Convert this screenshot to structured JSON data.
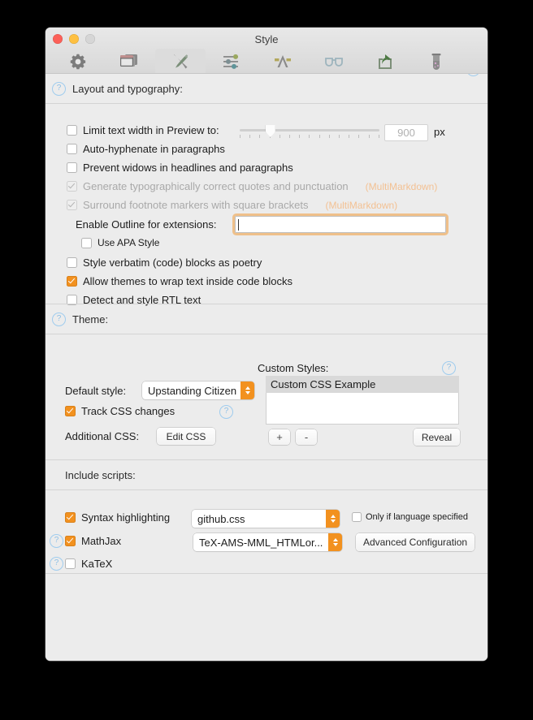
{
  "window": {
    "title": "Style",
    "traffic_lights": [
      "close",
      "minimize",
      "zoom"
    ]
  },
  "toolbar": {
    "items": [
      {
        "label": "General",
        "icon": "gear-icon",
        "selected": false
      },
      {
        "label": "Preview",
        "icon": "windows-icon",
        "selected": false
      },
      {
        "label": "Style",
        "icon": "brush-pen-icon",
        "selected": true
      },
      {
        "label": "Processor",
        "icon": "sliders-icon",
        "selected": false
      },
      {
        "label": "Apps",
        "icon": "compass-a-icon",
        "selected": false
      },
      {
        "label": "Proofing",
        "icon": "glasses-icon",
        "selected": false
      },
      {
        "label": "Export",
        "icon": "share-icon",
        "selected": false
      },
      {
        "label": "Advanced",
        "icon": "test-tube-icon",
        "selected": false
      }
    ]
  },
  "sections": {
    "layout": {
      "title": "Layout and typography:",
      "help_label": "?",
      "limit_width": {
        "label": "Limit text width in Preview to:",
        "checked": false,
        "slider_percent": 22,
        "value": "900",
        "unit": "px"
      },
      "checkboxes": [
        {
          "label": "Auto-hyphenate in paragraphs",
          "checked": false,
          "disabled": false,
          "tag": ""
        },
        {
          "label": "Prevent widows in headlines and paragraphs",
          "checked": false,
          "disabled": false,
          "tag": ""
        },
        {
          "label": "Generate typographically correct quotes and punctuation",
          "checked": true,
          "disabled": true,
          "tag": "(MultiMarkdown)"
        },
        {
          "label": "Surround footnote markers with square brackets",
          "checked": true,
          "disabled": true,
          "tag": "(MultiMarkdown)"
        }
      ],
      "outline": {
        "label": "Enable Outline for extensions:",
        "value": "",
        "focused": true
      },
      "apa": {
        "label": "Use APA Style",
        "checked": false
      },
      "bottom_checkboxes": [
        {
          "label": "Style verbatim (code) blocks as poetry",
          "checked": false
        },
        {
          "label": "Allow themes to wrap text inside code blocks",
          "checked": true
        },
        {
          "label": "Detect and style RTL text",
          "checked": false
        }
      ]
    },
    "theme": {
      "title": "Theme:",
      "default_style": {
        "label": "Default style:",
        "value": "Upstanding Citizen"
      },
      "track_css": {
        "label": "Track CSS changes",
        "checked": true
      },
      "additional_css": {
        "label": "Additional CSS:",
        "button": "Edit CSS"
      },
      "custom_styles": {
        "label": "Custom Styles:",
        "items": [
          {
            "name": "Custom CSS Example",
            "selected": true
          }
        ],
        "add_button": "+",
        "remove_button": "-",
        "reveal_button": "Reveal"
      }
    },
    "scripts": {
      "title": "Include scripts:",
      "syntax": {
        "label": "Syntax highlighting",
        "checked": true,
        "value": "github.css",
        "only_if_language": {
          "label": "Only if language specified",
          "checked": false
        }
      },
      "mathjax": {
        "label": "MathJax",
        "checked": true,
        "value": "TeX-AMS-MML_HTMLor...",
        "button": "Advanced Configuration"
      },
      "katex": {
        "label": "KaTeX",
        "checked": false
      }
    }
  },
  "colors": {
    "accent": "#f2911f",
    "help_blue": "#8cbfe6",
    "multimarkdown_tag": "#f3c193",
    "window_bg": "#ececec"
  }
}
